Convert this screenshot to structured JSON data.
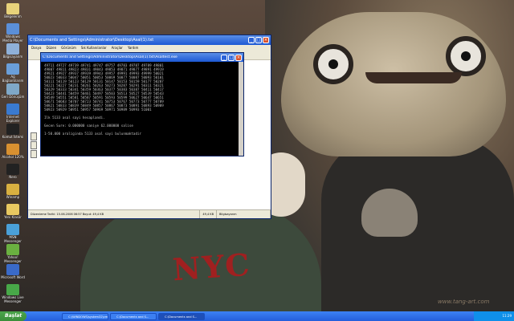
{
  "desktop_icons": [
    {
      "label": "Belgelerim",
      "color": "#e8d27a"
    },
    {
      "label": "Windows Media Player",
      "color": "#5b8fd8"
    },
    {
      "label": "Bilgisayarım",
      "color": "#8fb0d8"
    },
    {
      "label": "Ağ Bağlantılarım",
      "color": "#6a9ed8"
    },
    {
      "label": "Geri Dönüşüm",
      "color": "#7fa8c8"
    },
    {
      "label": "Internet Explorer",
      "color": "#3a7ad0"
    },
    {
      "label": "Komut İstemi",
      "color": "#222222"
    },
    {
      "label": "Alcohol 120%",
      "color": "#d89030"
    },
    {
      "label": "Nero",
      "color": "#222222"
    },
    {
      "label": "Winamp",
      "color": "#d8b040"
    },
    {
      "label": "Yeni Klasör",
      "color": "#e8c860"
    },
    {
      "label": "MSN Messenger",
      "color": "#4aa0d8"
    },
    {
      "label": "Yahoo! Messenger",
      "color": "#6ab040"
    },
    {
      "label": "Microsoft Word",
      "color": "#3a6ac8"
    },
    {
      "label": "Windows Live Messenger",
      "color": "#48a848"
    }
  ],
  "explorer": {
    "title": "C:\\Documents and Settings\\Administrator\\Desktop\\Asal(1).txt",
    "menu": [
      "Dosya",
      "Düzen",
      "Görünüm",
      "Sık Kullanılanlar",
      "Araçlar",
      "Yardım"
    ],
    "status_left": "Düzenleme Tarihi: 15.06.2006 06:57 Boyut: 49,4 KB",
    "status_mid": "49,4 KB",
    "status_right": "Bilgisayarım"
  },
  "cmd": {
    "title": "C:\\Documents and Settings\\Administrator\\Desktop\\Asal(1).txt\\Asaltest.exe",
    "lines": [
      "49711 49727 49739 49741 49747 49757 49783 49787 49789 49801",
      "49807 49811 49823 49831 49843 49853 49871 49877 49891 49919",
      "49921 49927 49937 49939 49943 49957 49991 49993 49999 50021",
      "50023 50033 50047 50051 50053 50069 50077 50087 50093 50101",
      "50111 50119 50123 50129 50131 50147 50153 50159 50177 50207",
      "50221 50227 50231 50261 50263 50273 50287 50291 50311 50321",
      "50329 50333 50341 50359 50363 50377 50383 50387 50411 50417",
      "50423 50441 50459 50461 50497 50503 50513 50527 50539 50543",
      "50549 50551 50581 50587 50591 50593 50599 50627 50647 50651",
      "50671 50683 50707 50723 50741 50753 50767 50773 50777 50789",
      "50821 50833 50839 50849 50857 50867 50873 50891 50893 50909",
      "50923 50929 50951 50957 50969 50971 50989 50993 51001"
    ],
    "summary": "Ilk 5133 asal sayi hesaplandi.",
    "timing": "Gecen Sure: 0.000000 saniye 62.000000 salise",
    "prompt": "1-50.000 araliginda 5133 asal sayi bulunmaktadir"
  },
  "taskbar": {
    "start_label": "Başlat",
    "tasks": [
      "C:\\WINDOWS\\system32\\cmd.exe",
      "C:\\Documents and S...",
      "C:\\Documents and S..."
    ],
    "clock": "11:29"
  },
  "wallpaper": {
    "shirt_text": "NYC",
    "signature": "www.tang-art.com"
  }
}
